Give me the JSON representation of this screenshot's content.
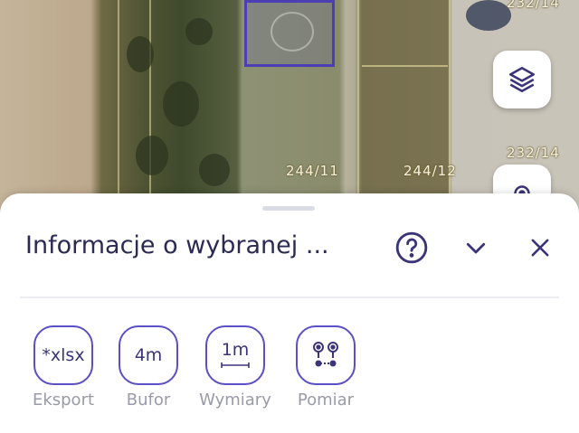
{
  "map": {
    "parcel_labels": [
      "244/11",
      "244/12",
      "232/14",
      "232/14"
    ],
    "layers_icon": "layers-icon",
    "locate_icon": "locate-icon"
  },
  "sheet": {
    "title": "Informacje o wybranej ...",
    "help_icon": "help-icon",
    "collapse_icon": "chevron-down-icon",
    "close_icon": "close-icon",
    "tools": [
      {
        "value": "*xlsx",
        "label": "Eksport"
      },
      {
        "value": "4m",
        "label": "Bufor"
      },
      {
        "value": "1m",
        "label": "Wymiary"
      },
      {
        "value": "",
        "label": "Pomiar",
        "icon": "measure-icon"
      }
    ]
  },
  "colors": {
    "accent": "#5a4fc4",
    "title": "#2b2a52",
    "label": "#9a9aa8"
  }
}
